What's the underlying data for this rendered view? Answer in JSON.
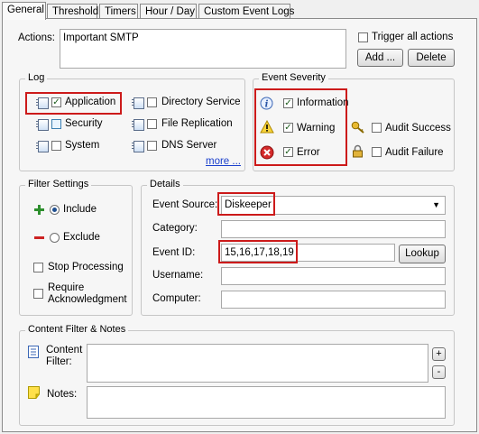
{
  "tabs": [
    "General",
    "Threshold",
    "Timers",
    "Hour / Day",
    "Custom Event Logs"
  ],
  "actions": {
    "label": "Actions:",
    "value": "Important SMTP",
    "trigger_all_label": "Trigger all actions",
    "add_label": "Add ...",
    "delete_label": "Delete"
  },
  "log": {
    "title": "Log",
    "items": [
      {
        "label": "Application",
        "checked": true
      },
      {
        "label": "Security",
        "checked": false
      },
      {
        "label": "System",
        "checked": false
      },
      {
        "label": "Directory Service",
        "checked": false
      },
      {
        "label": "File Replication",
        "checked": false
      },
      {
        "label": "DNS Server",
        "checked": false
      }
    ],
    "more_label": "more ..."
  },
  "severity": {
    "title": "Event Severity",
    "items": [
      {
        "label": "Information",
        "checked": true,
        "icon": "information-icon"
      },
      {
        "label": "Warning",
        "checked": true,
        "icon": "warning-icon"
      },
      {
        "label": "Error",
        "checked": true,
        "icon": "error-icon"
      },
      {
        "label": "Audit Success",
        "checked": false,
        "icon": "key-icon"
      },
      {
        "label": "Audit Failure",
        "checked": false,
        "icon": "lock-icon"
      }
    ]
  },
  "filter": {
    "title": "Filter Settings",
    "include_label": "Include",
    "exclude_label": "Exclude",
    "selected": "Include",
    "stop_processing_label": "Stop Processing",
    "require_ack_line1": "Require",
    "require_ack_line2": "Acknowledgment"
  },
  "details": {
    "title": "Details",
    "event_source_label": "Event Source:",
    "event_source_value": "Diskeeper",
    "category_label": "Category:",
    "category_value": "",
    "event_id_label": "Event ID:",
    "event_id_value": "15,16,17,18,19",
    "lookup_label": "Lookup",
    "username_label": "Username:",
    "username_value": "",
    "computer_label": "Computer:",
    "computer_value": ""
  },
  "content": {
    "title": "Content Filter & Notes",
    "filter_label_line1": "Content",
    "filter_label_line2": "Filter:",
    "filter_value": "",
    "notes_label": "Notes:",
    "notes_value": "",
    "plus_label": "+",
    "minus_label": "-"
  },
  "colors": {
    "highlight": "#cc1a1a",
    "link": "#1a3fcc"
  }
}
